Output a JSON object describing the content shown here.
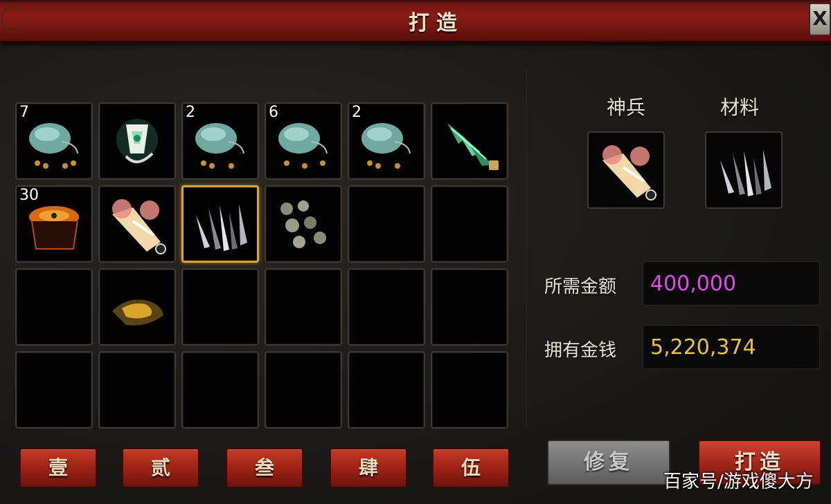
{
  "window": {
    "title": "打造",
    "close_label": "X"
  },
  "inventory": {
    "slots": [
      {
        "id": "r1c1",
        "count": "7",
        "icon": "pouch-icon"
      },
      {
        "id": "r1c2",
        "count": "",
        "icon": "glowing-amulet-icon"
      },
      {
        "id": "r1c3",
        "count": "2",
        "icon": "pouch-icon"
      },
      {
        "id": "r1c4",
        "count": "6",
        "icon": "pouch-icon"
      },
      {
        "id": "r1c5",
        "count": "2",
        "icon": "pouch-icon"
      },
      {
        "id": "r1c6",
        "count": "",
        "icon": "jade-crystal-icon",
        "locked": true
      },
      {
        "id": "r2c1",
        "count": "30",
        "icon": "ember-ore-icon"
      },
      {
        "id": "r2c2",
        "count": "",
        "icon": "divine-weapon-icon",
        "timed": true
      },
      {
        "id": "r2c3",
        "count": "",
        "icon": "iron-crystal-icon",
        "selected": true
      },
      {
        "id": "r2c4",
        "count": "",
        "icon": "ore-pebbles-icon"
      },
      {
        "id": "r3c2",
        "count": "",
        "icon": "gold-ore-icon"
      }
    ]
  },
  "panel": {
    "weapon_label": "神兵",
    "material_label": "材料",
    "weapon_icon": "divine-weapon-icon",
    "material_icon": "iron-crystal-icon",
    "required_label": "所需金额",
    "required_value": "400,000",
    "owned_label": "拥有金钱",
    "owned_value": "5,220,374",
    "required_color": "#e04ce8",
    "owned_color": "#e9c43a"
  },
  "tabs": [
    "壹",
    "贰",
    "叁",
    "肆",
    "伍"
  ],
  "actions": {
    "repair_label": "修复",
    "forge_label": "打造"
  },
  "watermark": "百家号/游戏傻大方"
}
